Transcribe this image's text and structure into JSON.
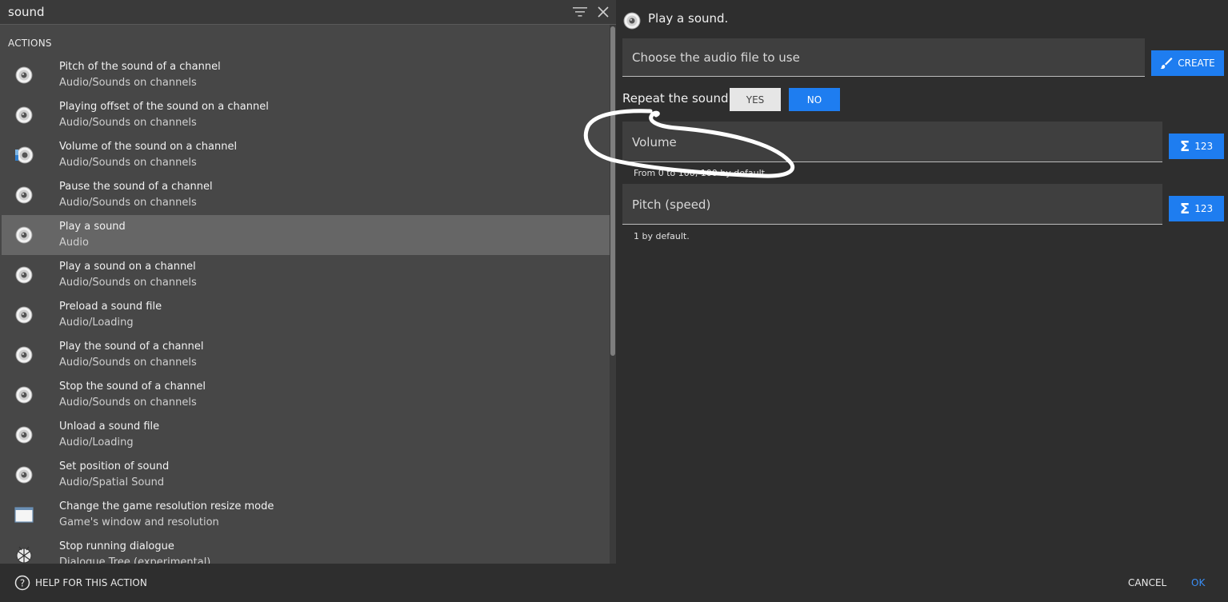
{
  "search": {
    "value": "sound"
  },
  "section_title": "ACTIONS",
  "actions": [
    {
      "title": "Pitch of the sound of a channel",
      "category": "Audio/Sounds on channels",
      "icon": "speaker-icon"
    },
    {
      "title": "Playing offset of the sound on a channel",
      "category": "Audio/Sounds on channels",
      "icon": "speaker-icon"
    },
    {
      "title": "Volume of the sound on a channel",
      "category": "Audio/Sounds on channels",
      "icon": "volume-speaker-icon"
    },
    {
      "title": "Pause the sound of a channel",
      "category": "Audio/Sounds on channels",
      "icon": "speaker-icon"
    },
    {
      "title": "Play a sound",
      "category": "Audio",
      "icon": "speaker-icon",
      "selected": true
    },
    {
      "title": "Play a sound on a channel",
      "category": "Audio/Sounds on channels",
      "icon": "speaker-icon"
    },
    {
      "title": "Preload a sound file",
      "category": "Audio/Loading",
      "icon": "speaker-icon"
    },
    {
      "title": "Play the sound of a channel",
      "category": "Audio/Sounds on channels",
      "icon": "speaker-icon"
    },
    {
      "title": "Stop the sound of a channel",
      "category": "Audio/Sounds on channels",
      "icon": "speaker-icon"
    },
    {
      "title": "Unload a sound file",
      "category": "Audio/Loading",
      "icon": "speaker-icon"
    },
    {
      "title": "Set position of sound",
      "category": "Audio/Spatial Sound",
      "icon": "speaker-icon"
    },
    {
      "title": "Change the game resolution resize mode",
      "category": "Game's window and resolution",
      "icon": "window-icon"
    },
    {
      "title": "Stop running dialogue",
      "category": "Dialogue Tree (experimental)",
      "icon": "dialogue-ball-icon"
    }
  ],
  "detail": {
    "title": "Play a sound.",
    "audio_field_label": "Choose the audio file to use",
    "create_label": "CREATE",
    "repeat_label": "Repeat the sound",
    "yes_label": "YES",
    "no_label": "NO",
    "volume_label": "Volume",
    "volume_helper": "From 0 to 100, 100 by default.",
    "pitch_label": "Pitch (speed)",
    "pitch_helper": "1 by default.",
    "expr_label": "123"
  },
  "footer": {
    "help_label": "HELP FOR THIS ACTION",
    "cancel_label": "CANCEL",
    "ok_label": "OK"
  },
  "colors": {
    "accent": "#1e7df0",
    "selected_row": "#666666",
    "panel": "#474747",
    "background": "#2e2e2e"
  }
}
